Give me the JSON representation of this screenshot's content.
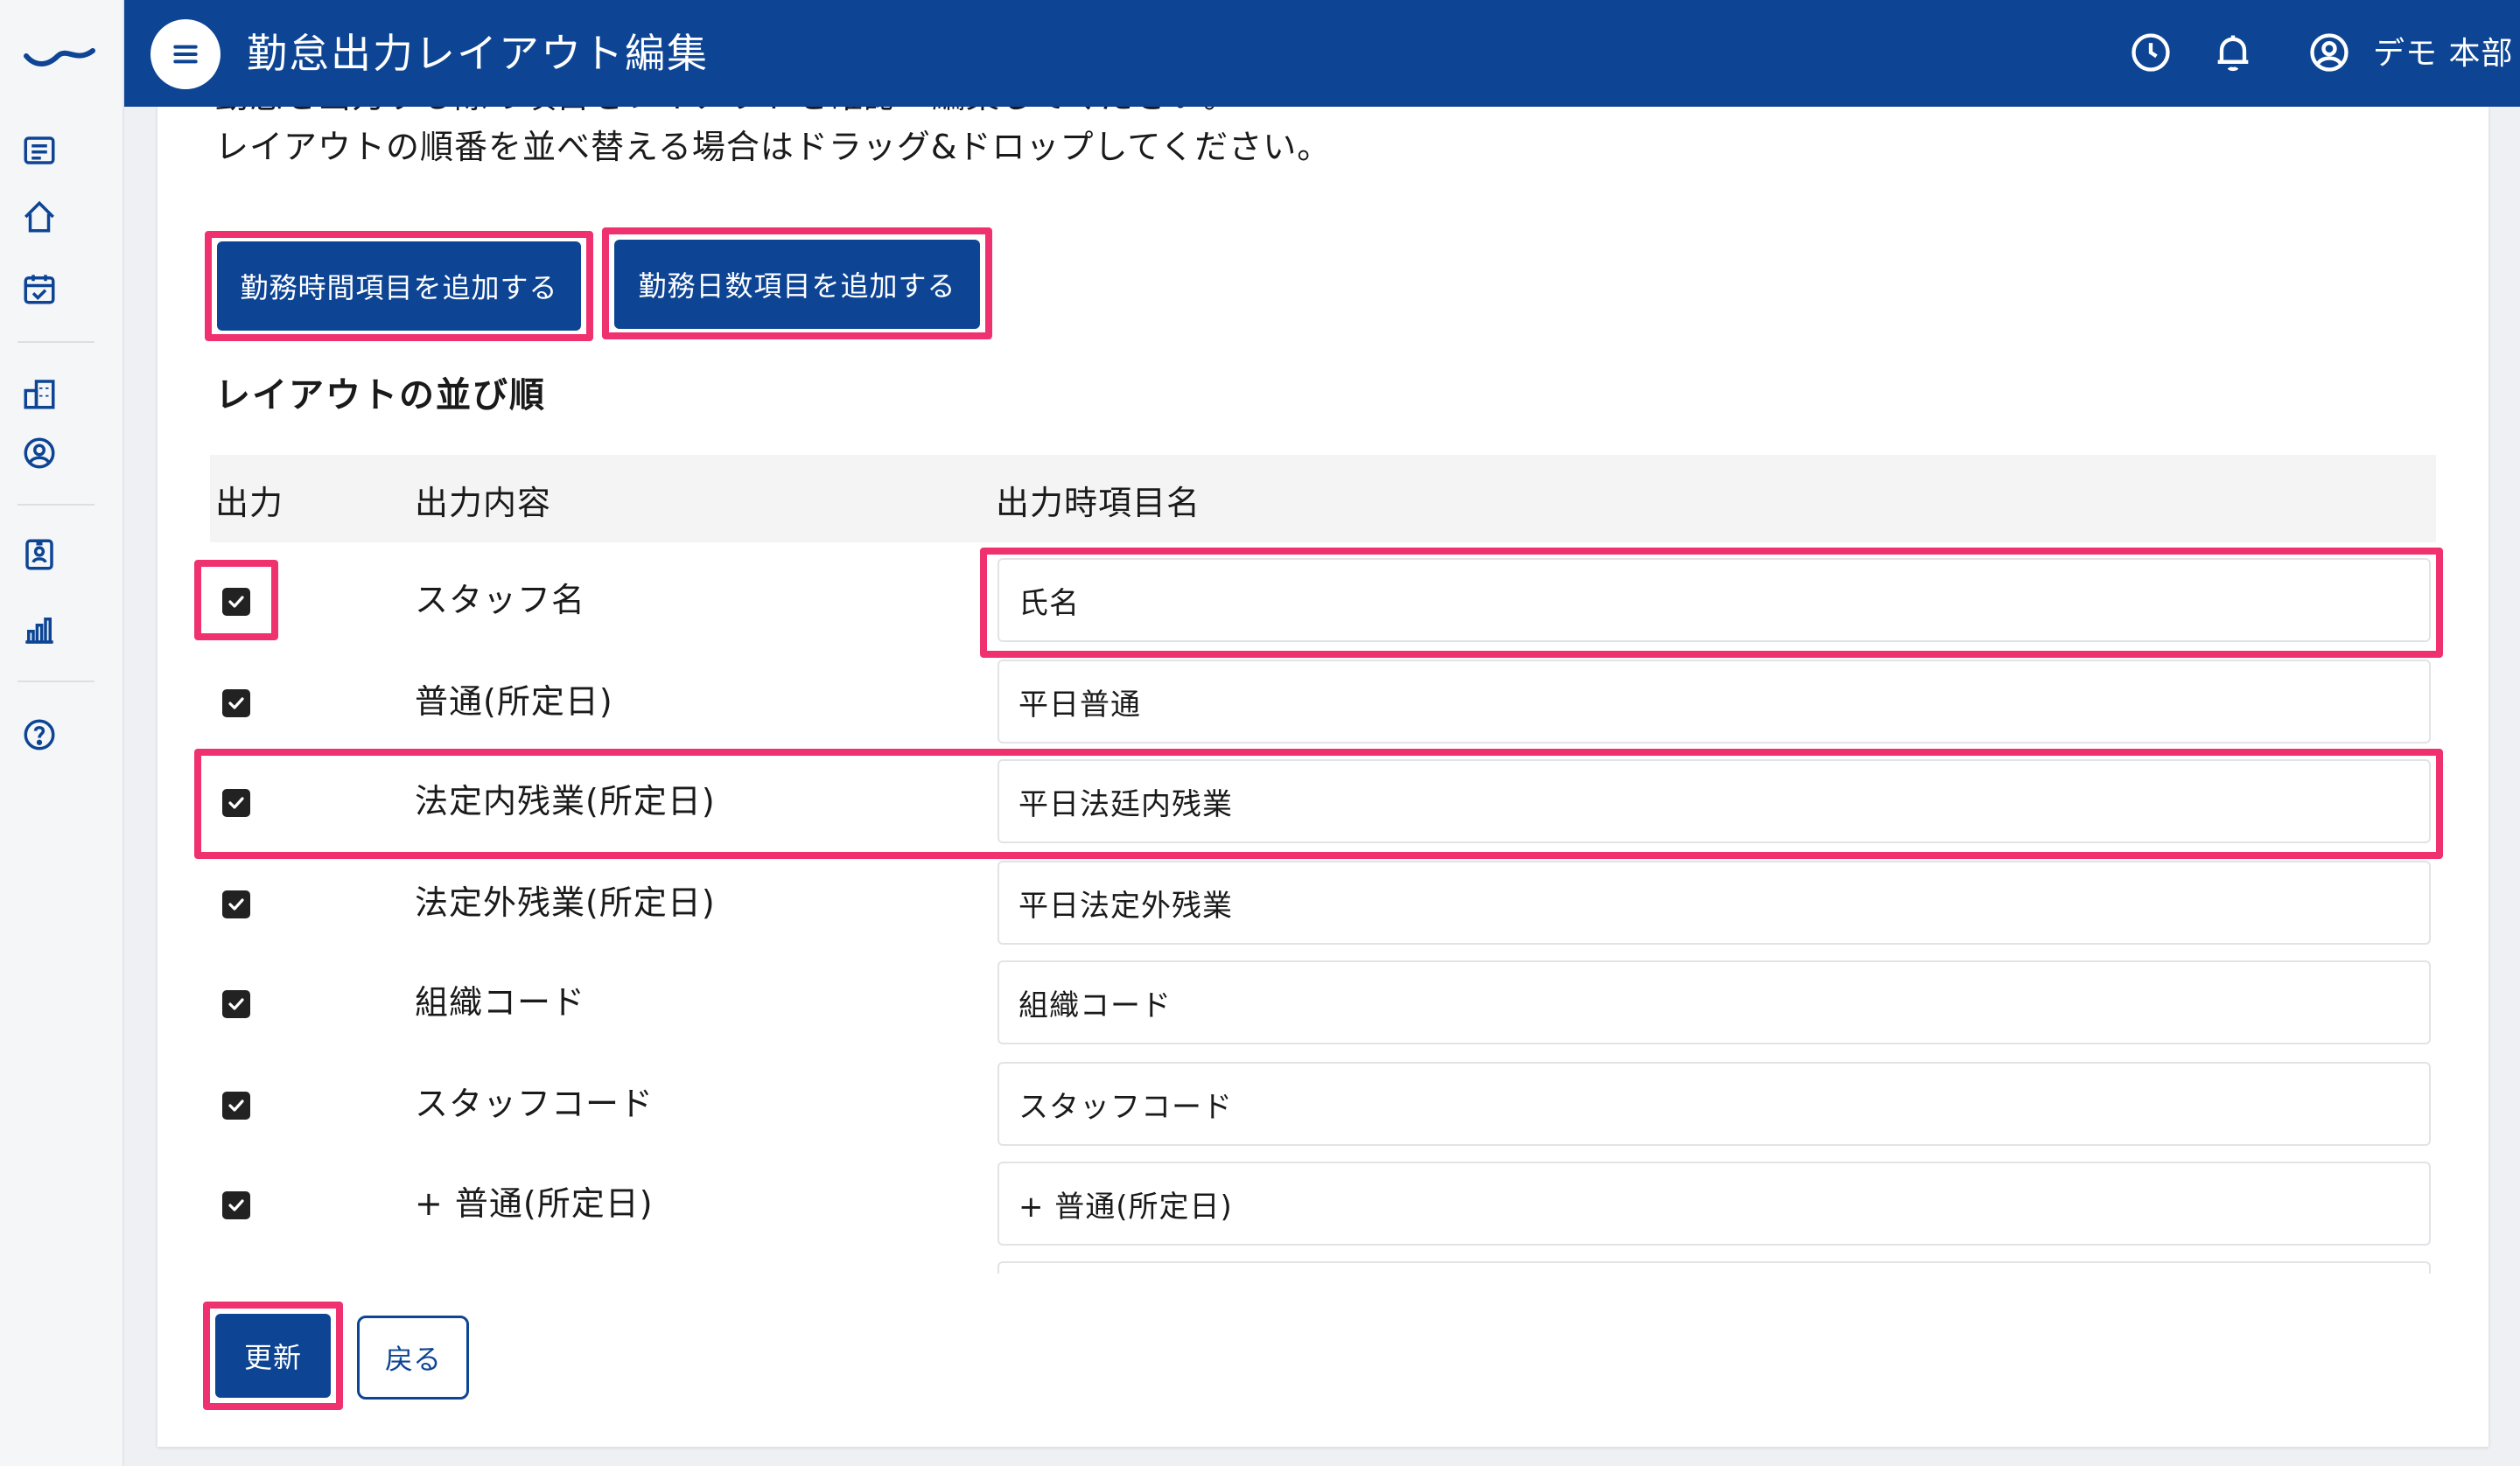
{
  "app": {
    "title": "勤怠出力レイアウト編集",
    "user_name": "デモ 本部",
    "colors": {
      "primary": "#0d4594",
      "highlight": "#f0316f"
    }
  },
  "sidebar": {
    "icons": [
      "list-icon",
      "home-icon",
      "calendar-check-icon",
      "building-icon",
      "user-circle-icon",
      "id-card-icon",
      "bar-chart-icon",
      "help-icon"
    ]
  },
  "content": {
    "desc_line_1": "勤怠を出力する際の項目をレイアウトを確認・編集してください。",
    "desc_line_2": "レイアウトの順番を並べ替える場合はドラッグ&ドロップしてください。",
    "add_work_time_label": "勤務時間項目を追加する",
    "add_work_days_label": "勤務日数項目を追加する",
    "section_title": "レイアウトの並び順",
    "columns": {
      "output": "出力",
      "content": "出力内容",
      "name": "出力時項目名"
    },
    "rows": [
      {
        "checked": true,
        "content": "スタッフ名",
        "name": "氏名"
      },
      {
        "checked": true,
        "content": "普通(所定日)",
        "name": "平日普通"
      },
      {
        "checked": true,
        "content": "法定内残業(所定日)",
        "name": "平日法廷内残業"
      },
      {
        "checked": true,
        "content": "法定外残業(所定日)",
        "name": "平日法定外残業"
      },
      {
        "checked": true,
        "content": "組織コード",
        "name": "組織コード"
      },
      {
        "checked": true,
        "content": "スタッフコード",
        "name": "スタッフコード"
      },
      {
        "checked": true,
        "content": "+ 普通(所定日)",
        "name": "+ 普通(所定日)"
      }
    ],
    "update_label": "更新",
    "back_label": "戻る"
  }
}
